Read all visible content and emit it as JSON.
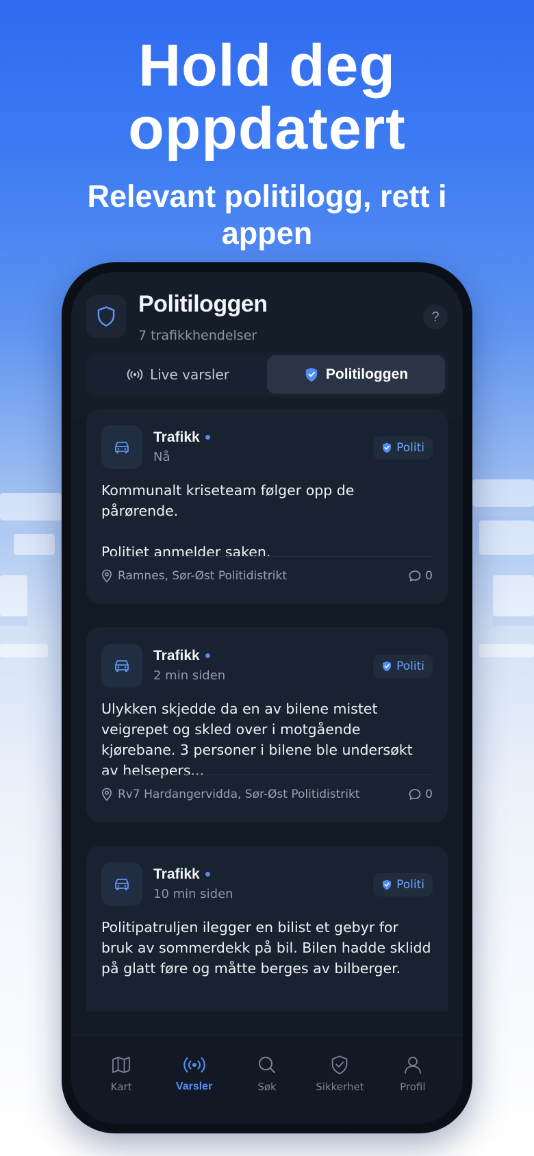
{
  "hero": {
    "headline": "Hold deg oppdatert",
    "subheadline": "Relevant politilogg, rett i appen"
  },
  "app": {
    "title": "Politiloggen",
    "subtitle": "7 trafikkhendelser",
    "help_label": "?",
    "tabs": [
      {
        "label": "Live varsler",
        "icon": "broadcast-icon",
        "active": false
      },
      {
        "label": "Politiloggen",
        "icon": "shield-check-icon",
        "active": true
      }
    ]
  },
  "feed": [
    {
      "category": "Trafikk",
      "time": "Nå",
      "badge": "Politi",
      "text": "Kommunalt kriseteam følger opp de pårørende.\n\nPolitiet anmelder saken.",
      "location": "Ramnes, Sør-Øst Politidistrikt",
      "comments": "0"
    },
    {
      "category": "Trafikk",
      "time": "2 min siden",
      "badge": "Politi",
      "text": "Ulykken skjedde da en av bilene mistet veigrepet og skled over i motgående kjørebane. 3 personer i bilene ble undersøkt av helsepers...",
      "location": "Rv7 Hardangervidda, Sør-Øst Politidistrikt",
      "comments": "0"
    },
    {
      "category": "Trafikk",
      "time": "10 min siden",
      "badge": "Politi",
      "text": "Politipatruljen ilegger en bilist et gebyr for bruk av sommerdekk på bil. Bilen hadde sklidd på glatt føre og måtte berges av bilberger.",
      "location": "",
      "comments": ""
    }
  ],
  "nav": [
    {
      "label": "Kart",
      "icon": "map-icon",
      "active": false
    },
    {
      "label": "Varsler",
      "icon": "broadcast-icon",
      "active": true
    },
    {
      "label": "Søk",
      "icon": "search-icon",
      "active": false
    },
    {
      "label": "Sikkerhet",
      "icon": "shield-check-icon",
      "active": false
    },
    {
      "label": "Profil",
      "icon": "user-icon",
      "active": false
    }
  ],
  "colors": {
    "accent": "#4f8df5",
    "background_top": "#2f6bf0",
    "screen": "#121a26",
    "card": "#192230"
  }
}
